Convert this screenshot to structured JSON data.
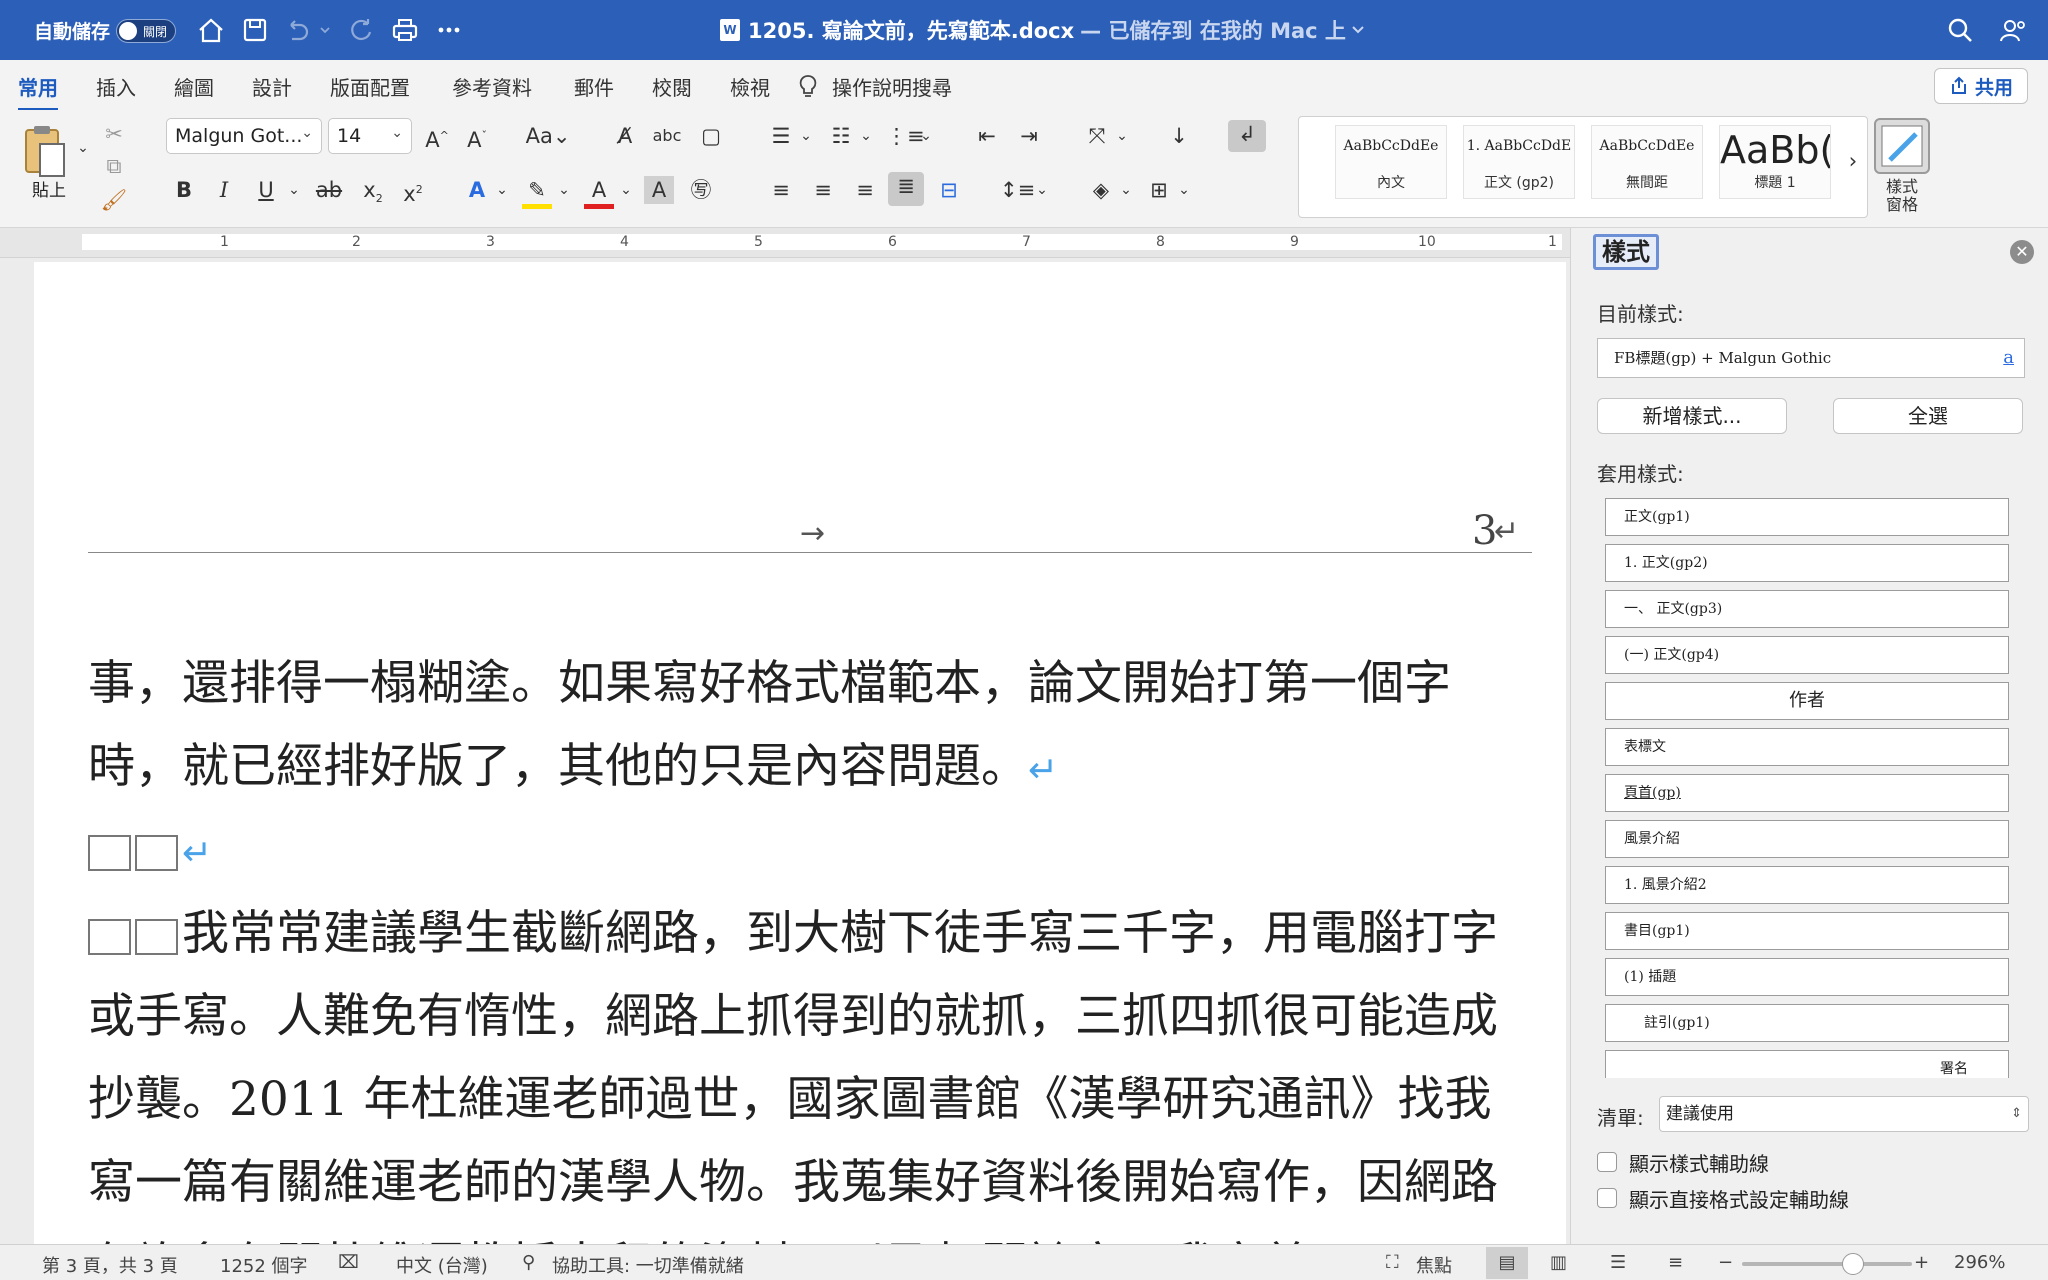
{
  "titlebar": {
    "autosave_label": "自動儲存",
    "autosave_state": "關閉",
    "doc_name": "1205. 寫論文前，先寫範本.docx",
    "save_status": "— 已儲存到 在我的 Mac 上",
    "word_badge": "W"
  },
  "tabs": [
    "常用",
    "插入",
    "繪圖",
    "設計",
    "版面配置",
    "參考資料",
    "郵件",
    "校閱",
    "檢視"
  ],
  "tell_me": "操作說明搜尋",
  "share_label": "共用",
  "ribbon": {
    "paste_label": "貼上",
    "font_name": "Malgun Got...",
    "font_size": "14",
    "styles_gallery": [
      {
        "preview": "AaBbCcDdEe",
        "label": "內文"
      },
      {
        "preview": "1.  AaBbCcDdE",
        "label": "正文 (gp2)"
      },
      {
        "preview": "AaBbCcDdEe",
        "label": "無間距"
      },
      {
        "preview": "AaBb(",
        "label": "標題 1"
      }
    ],
    "style_pane_label": "樣式\n窗格"
  },
  "ruler_numbers": [
    "1",
    "2",
    "3",
    "4",
    "5",
    "6",
    "7",
    "8",
    "9",
    "10",
    "1"
  ],
  "document": {
    "header_page_number": "3",
    "paragraph1": "事，還排得一榻糊塗。如果寫好格式檔範本，論文開始打第一個字時，就已經排好版了，其他的只是內容問題。",
    "paragraph2": "我常常建議學生截斷網路，到大樹下徒手寫三千字，用電腦打字或手寫。人難免有惰性，網路上抓得到的就抓，三抓四抓很可能造成抄襲。2011 年杜維運老師過世，國家圖書館《漢學研究通訊》找我寫一篇有關維運老師的漢學人物。我蒐集好資料後開始寫作，因網路有許多有關杜維運教授去留的資料，以及相關論文，我字美"
  },
  "style_pane": {
    "title": "樣式",
    "current_label": "目前樣式:",
    "current_value": "FB標題(gp) + Malgun Gothic",
    "new_style_btn": "新增樣式...",
    "select_all_btn": "全選",
    "apply_label": "套用樣式:",
    "styles": [
      "正文(gp1)",
      "1.  正文(gp2)",
      "一、 正文(gp3)",
      "(一) 正文(gp4)",
      "作者",
      "表標文",
      "頁首(gp)",
      "風景介紹",
      "1. 風景介紹2",
      "書目(gp1)",
      "(1)  插題",
      "註引(gp1)",
      "署名"
    ],
    "list_label": "清單:",
    "list_value": "建議使用",
    "show_guides": "顯示樣式輔助線",
    "show_direct_guides": "顯示直接格式設定輔助線"
  },
  "statusbar": {
    "page": "第 3 頁，共 3 頁",
    "words": "1252 個字",
    "language": "中文 (台灣)",
    "accessibility": "協助工具: 一切準備就緒",
    "focus": "焦點",
    "zoom": "296%"
  },
  "colors": {
    "titlebar": "#2b5fb8",
    "accent": "#1e5bbf",
    "return_mark": "#4aa3e8"
  }
}
